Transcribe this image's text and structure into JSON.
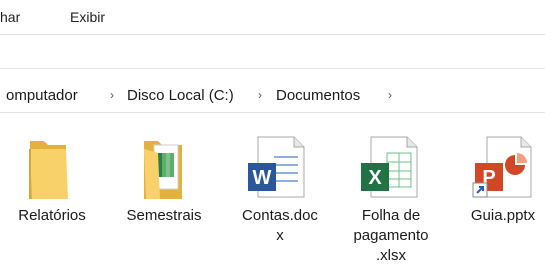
{
  "menu": {
    "share": "har",
    "view": "Exibir"
  },
  "breadcrumb": [
    "omputador",
    "Disco Local (C:)",
    "Documentos"
  ],
  "files": [
    {
      "name": "Relatórios",
      "icon": "folder-icon"
    },
    {
      "name": "Semestrais",
      "icon": "folder-with-files-icon"
    },
    {
      "name_line1": "Contas.doc",
      "name_line2": "x",
      "icon": "word-document-icon"
    },
    {
      "name_line1": "Folha de",
      "name_line2": "pagamento",
      "name_line3": ".xlsx",
      "icon": "excel-spreadsheet-icon"
    },
    {
      "name": "Guia.pptx",
      "icon": "powerpoint-shortcut-icon"
    }
  ],
  "colors": {
    "folder": "#F5C84C",
    "word": "#2B579A",
    "excel": "#217346",
    "powerpoint": "#D24726"
  }
}
